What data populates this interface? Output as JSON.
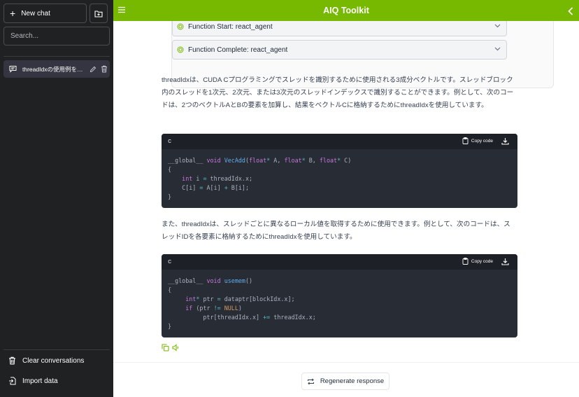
{
  "sidebar": {
    "new_chat_label": "New chat",
    "search_placeholder": "Search...",
    "conversations": [
      {
        "label": "threadIdxの使用例を提..."
      }
    ],
    "clear_label": "Clear conversations",
    "import_label": "Import data"
  },
  "header": {
    "title": "AIQ Toolkit"
  },
  "main": {
    "function_start": "Function Start: react_agent",
    "function_complete": "Function Complete: react_agent",
    "paragraph1": "threadIdxは、CUDA Cプログラミングでスレッドを識別するために使用される3成分ベクトルです。スレッドブロック内のスレッドを1次元、2次元、または3次元のスレッドインデックスで識別することができます。例として、次のコードは、2つのベクトルAとBの要素を加算し、結果をベクトルCに格納するためにthreadIdxを使用しています。",
    "paragraph2": "また、threadIdxは、スレッドごとに異なるローカル値を取得するために使用できます。例として、次のコードは、スレッドIDを各要素に格納するためにthreadIdxを使用しています。",
    "code_blocks": [
      {
        "language": "c",
        "copy_label": "Copy code"
      },
      {
        "language": "c",
        "copy_label": "Copy code"
      }
    ]
  },
  "footer": {
    "regenerate_label": "Regenerate response"
  },
  "colors": {
    "brand": "#76b900",
    "sidebar_bg": "#202123",
    "code_bg": "#282c34"
  }
}
